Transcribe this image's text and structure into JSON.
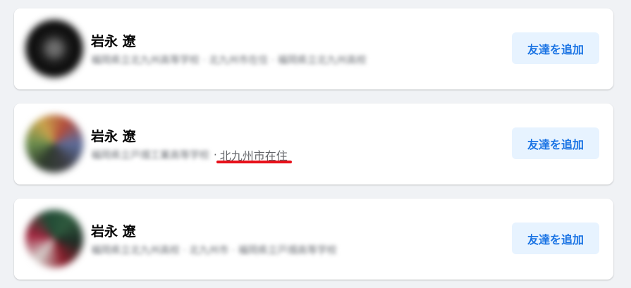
{
  "results": [
    {
      "name": "岩永 遼",
      "subtitle_obscured": "福岡県立北九州高等学校 · 北九州市在住 · 福岡県立北九州高校",
      "location": "",
      "add_friend_label": "友達を追加"
    },
    {
      "name": "岩永 遼",
      "subtitle_obscured": "福岡県立戸畑工業高等学校",
      "location": "北九州市在住",
      "add_friend_label": "友達を追加"
    },
    {
      "name": "岩永 遼",
      "subtitle_obscured": "福岡県立北九州高校 · 北九州市 · 福岡県立戸畑高等学校",
      "location": "",
      "add_friend_label": "友達を追加"
    }
  ],
  "separator": "·",
  "colors": {
    "page_bg": "#f0f2f5",
    "button_bg": "#e7f3ff",
    "button_text": "#1b74e4",
    "highlight_underline": "#e8101a"
  }
}
